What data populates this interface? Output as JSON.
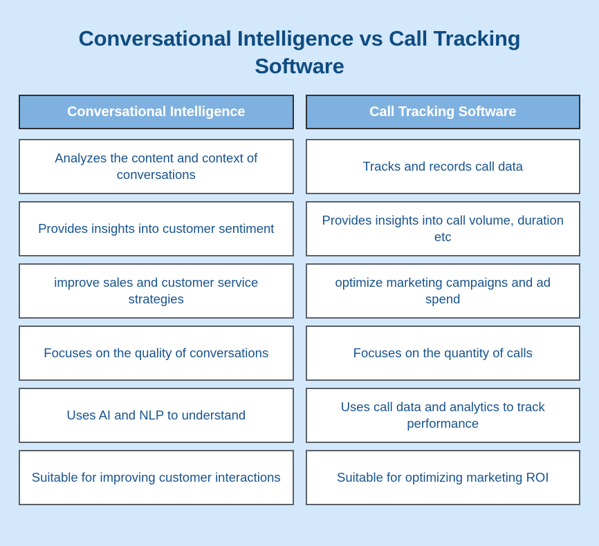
{
  "page": {
    "background_color": "#d4e8fb",
    "title": "Conversational Intelligence vs Call Tracking Software"
  },
  "theme": {
    "title_color": "#0f4c81",
    "header_fill": "#7fb1e0",
    "header_text_color": "#ffffff",
    "header_border_color": "#2c3137",
    "cell_fill": "#ffffff",
    "cell_text_color": "#18538f",
    "cell_border_color": "#5b6068"
  },
  "comparison_table": {
    "headers": [
      "Conversational Intelligence",
      "Call Tracking Software"
    ],
    "rows": [
      {
        "left": "Analyzes the content and context of conversations",
        "right": "Tracks and records call data"
      },
      {
        "left": "Provides insights into customer sentiment",
        "right": "Provides insights into call volume, duration etc"
      },
      {
        "left": "improve sales and customer service strategies",
        "right": "optimize marketing campaigns and ad spend"
      },
      {
        "left": "Focuses on the quality of conversations",
        "right": "Focuses on the quantity of calls"
      },
      {
        "left": "Uses AI and NLP to understand",
        "right": "Uses call data and analytics to track performance"
      },
      {
        "left": "Suitable for improving customer interactions",
        "right": "Suitable for optimizing marketing ROI"
      }
    ]
  }
}
